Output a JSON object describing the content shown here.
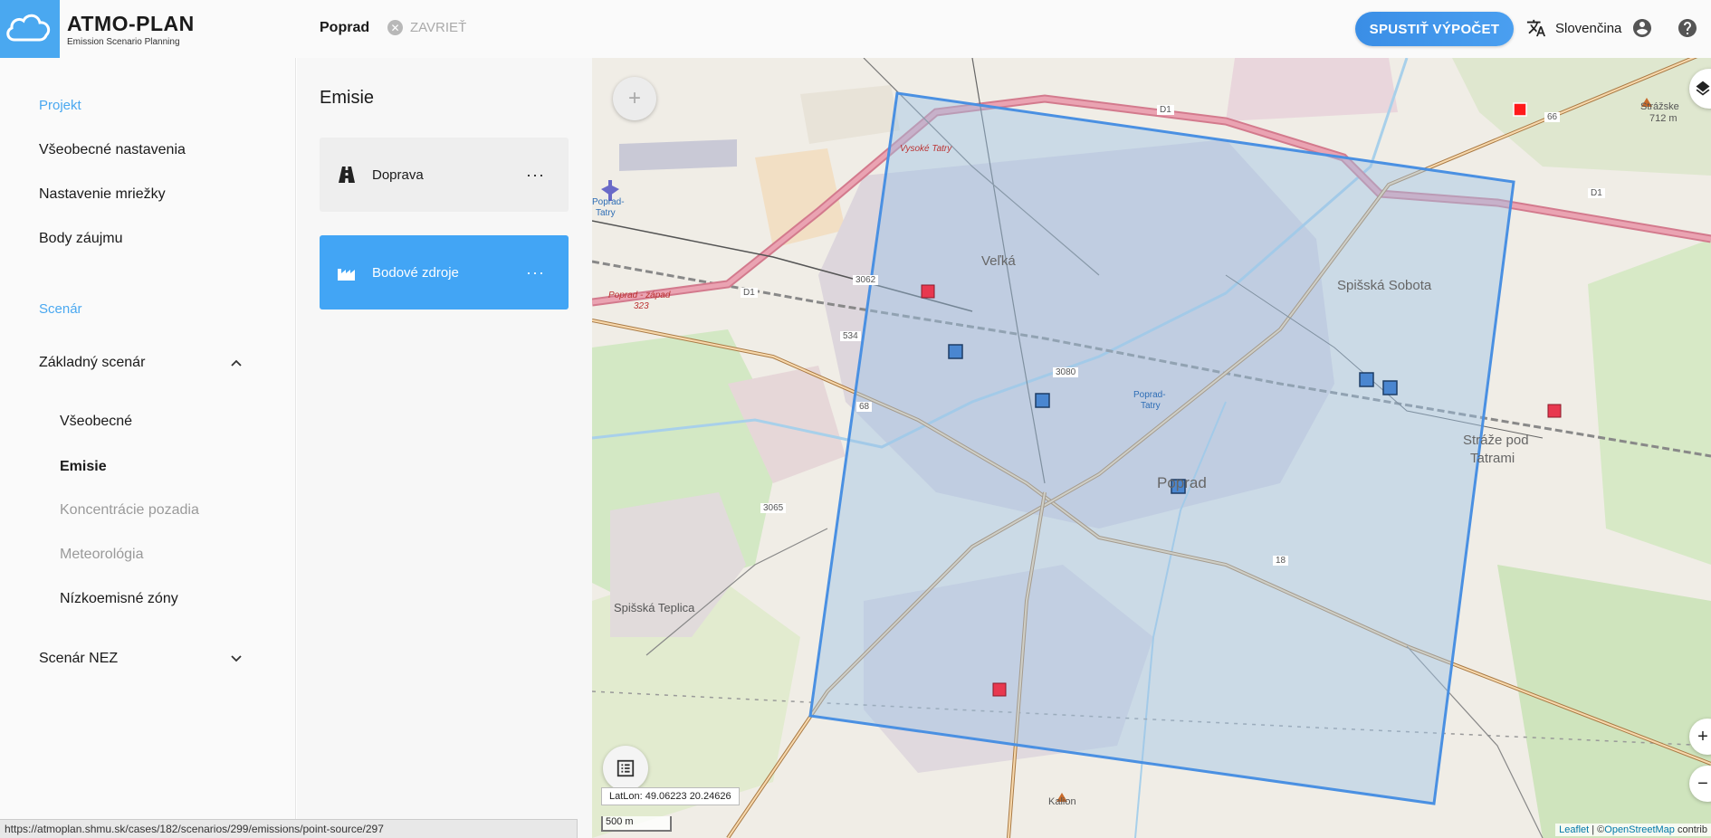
{
  "header": {
    "logo_title": "ATMO-PLAN",
    "logo_subtitle": "Emission Scenario Planning",
    "tab_name": "Poprad",
    "close_label": "ZAVRIEŤ",
    "run_button": "SPUSTIŤ VÝPOČET",
    "language": "Slovenčina",
    "icons": [
      "cloud-logo-icon",
      "close-circle-icon",
      "translate-icon",
      "account-icon",
      "help-icon"
    ]
  },
  "sidebar": {
    "section_project": "Projekt",
    "project_items": [
      "Všeobecné nastavenia",
      "Nastavenie mriežky",
      "Body záujmu"
    ],
    "section_scenario": "Scenár",
    "scenario_main": "Základný scenár",
    "scenario_sub": {
      "general": "Všeobecné",
      "emissions": "Emisie",
      "background": "Koncentrácie pozadia",
      "meteo": "Meteorológia",
      "lez": "Nízkoemisné zóny"
    },
    "scenario_nez": "Scenár NEZ"
  },
  "panel": {
    "title": "Emisie",
    "cards": [
      {
        "label": "Doprava",
        "icon": "road-icon",
        "more": "···"
      },
      {
        "label": "Bodové zdroje",
        "icon": "factory-icon",
        "more": "···"
      }
    ]
  },
  "map": {
    "coord_readout": "LatLon: 49.06223 20.24626",
    "scale_label": "500 m",
    "attribution_leaflet": "Leaflet",
    "attribution_sep": " | ©",
    "attribution_osm": "OpenStreetMap",
    "attribution_tail": " contrib",
    "labels": {
      "poprad": "Poprad",
      "spisska_sobota": "Spišská Sobota",
      "straze_1": "Stráže pod",
      "straze_2": "Tatrami",
      "spisska_teplica": "Spišská Teplica",
      "velka": "Veľká",
      "strazske": "Strážske",
      "strazske_elev": "712 m",
      "kalion": "Kalion",
      "vysoke_tatry": "Vysoké Tatry",
      "poprad_tatry_airport_1": "Poprad-",
      "poprad_tatry_airport_2": "Tatry",
      "poprad_tatry_station_1": "Poprad-",
      "poprad_tatry_station_2": "Tatry",
      "poprad_zapad": "Poprad - západ",
      "exit_323": "323",
      "d1_a": "D1",
      "d1_b": "D1",
      "d1_c": "D1",
      "road_534": "534",
      "road_3065": "3065",
      "road_3080": "3080",
      "road_3062": "3062",
      "road_66": "66",
      "road_18": "18",
      "road_68": "68"
    },
    "colors": {
      "grid_outline": "#4a90e2",
      "grid_fill": "#9dc4e6",
      "point_source_red": "#e8384f",
      "point_source_blue": "#4a86d0",
      "highway": "#e892a2"
    }
  },
  "statusbar": {
    "url": "https://atmoplan.shmu.sk/cases/182/scenarios/299/emissions/point-source/297"
  }
}
